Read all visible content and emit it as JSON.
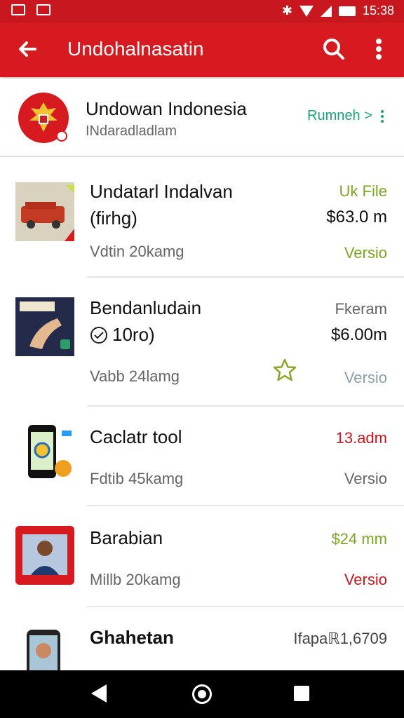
{
  "status_bar": {
    "time": "15:38"
  },
  "app_bar": {
    "title": "Undohalnasatin"
  },
  "header": {
    "title": "Undowan Indonesia",
    "subtitle": "INdaradladlam",
    "action_label": "Rumneh >"
  },
  "items": [
    {
      "title": "Undatarl Indalvan",
      "subline": "(firhg)",
      "meta": "Vdtin 20kamg",
      "r1": "Uk File",
      "r2": "$63.0 m",
      "r3": "Versio"
    },
    {
      "title": "Bendanludain",
      "subline": "10ro)",
      "meta": "Vabb 24lamg",
      "r1": "Fkeram",
      "r2": "$6.00m",
      "r3": "Versio"
    },
    {
      "title": "Caclatr tool",
      "meta": "Fdtib 45kamg",
      "r1": "13.adm",
      "r3": "Versio"
    },
    {
      "title": "Barabian",
      "meta": "Millb 20kamg",
      "r1": "$24 mm",
      "r3": "Versio"
    },
    {
      "title": "Ghahetan",
      "r1": "Ifapaℝ1,6709"
    }
  ],
  "colors": {
    "brand_red": "#d71920",
    "green": "#1aa37a",
    "olive": "#7aa823",
    "red_text": "#c8171e",
    "gray": "#666666"
  }
}
